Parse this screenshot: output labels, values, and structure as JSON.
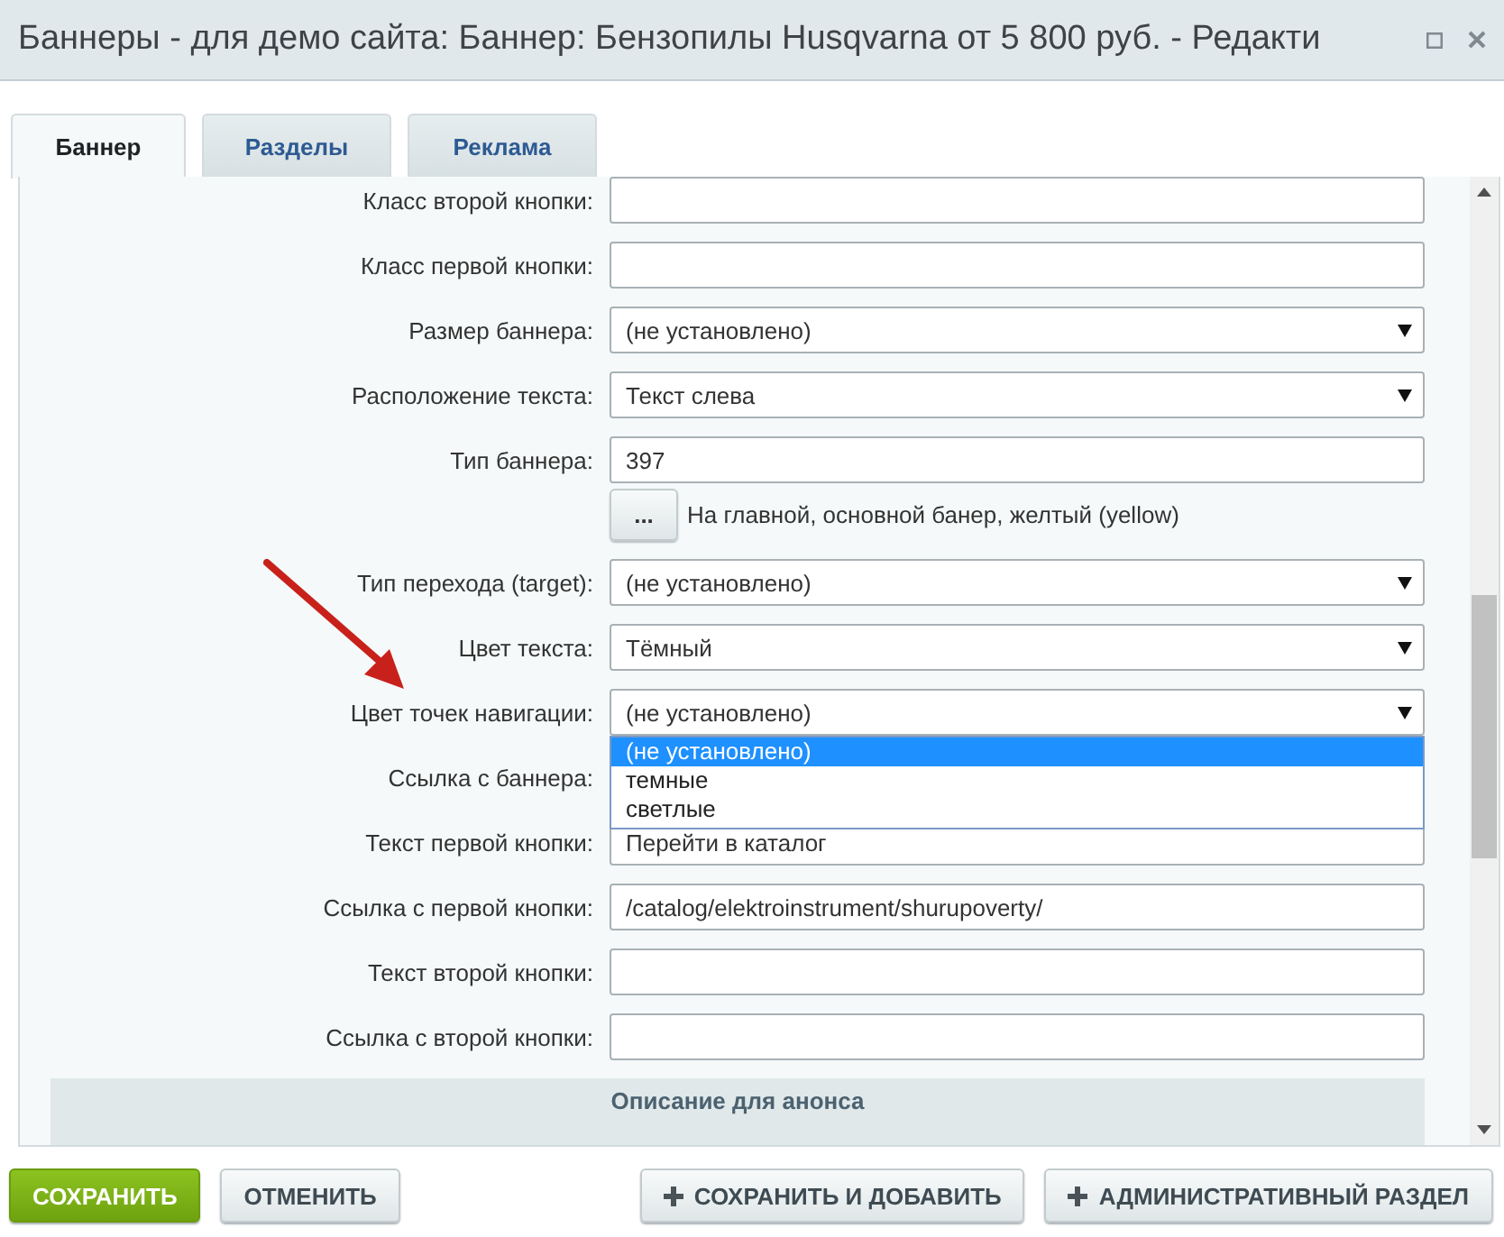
{
  "window": {
    "title": "Баннеры - для демо сайта: Баннер: Бензопилы Husqvarna от 5 800 руб. - Редакти"
  },
  "tabs": [
    {
      "label": "Баннер",
      "selected": true
    },
    {
      "label": "Разделы",
      "selected": false
    },
    {
      "label": "Реклама",
      "selected": false
    }
  ],
  "fields": [
    {
      "kind": "text",
      "label": "Класс второй кнопки:"
    },
    {
      "kind": "text",
      "label": "Класс первой кнопки:"
    },
    {
      "kind": "select",
      "label": "Размер баннера:",
      "value": "(не установлено)"
    },
    {
      "kind": "select",
      "label": "Расположение текста:",
      "value": "Текст слева"
    },
    {
      "kind": "picker",
      "label": "Тип баннера:",
      "value": "397",
      "button": "...",
      "description": "На главной, основной банер, желтый (yellow)"
    },
    {
      "kind": "select",
      "label": "Тип перехода (target):",
      "value": "(не установлено)"
    },
    {
      "kind": "select",
      "label": "Цвет текста:",
      "value": "Тёмный"
    },
    {
      "kind": "select",
      "label": "Цвет точек навигации:",
      "value": "(не установлено)",
      "expanded": true,
      "options": [
        {
          "label": "(не установлено)",
          "selected": true
        },
        {
          "label": "темные",
          "selected": false
        },
        {
          "label": "светлые",
          "selected": false
        }
      ]
    },
    {
      "kind": "covered",
      "label": "Ссылка с баннера:"
    },
    {
      "kind": "text",
      "label": "Текст первой кнопки:",
      "value": "Перейти в каталог"
    },
    {
      "kind": "text",
      "label": "Ссылка с первой кнопки:",
      "value": "/catalog/elektroinstrument/shurupoverty/"
    },
    {
      "kind": "text",
      "label": "Текст второй кнопки:"
    },
    {
      "kind": "text",
      "label": "Ссылка с второй кнопки:"
    }
  ],
  "section_heading": "Описание для анонса",
  "buttons": [
    {
      "kind": "primary",
      "label": "СОХРАНИТЬ"
    },
    {
      "kind": "plain",
      "label": "ОТМЕНИТЬ"
    },
    {
      "kind": "add",
      "label": "СОХРАНИТЬ И ДОБАВИТЬ"
    },
    {
      "kind": "add",
      "label": "АДМИНИСТРАТИВНЫЙ РАЗДЕЛ"
    }
  ]
}
